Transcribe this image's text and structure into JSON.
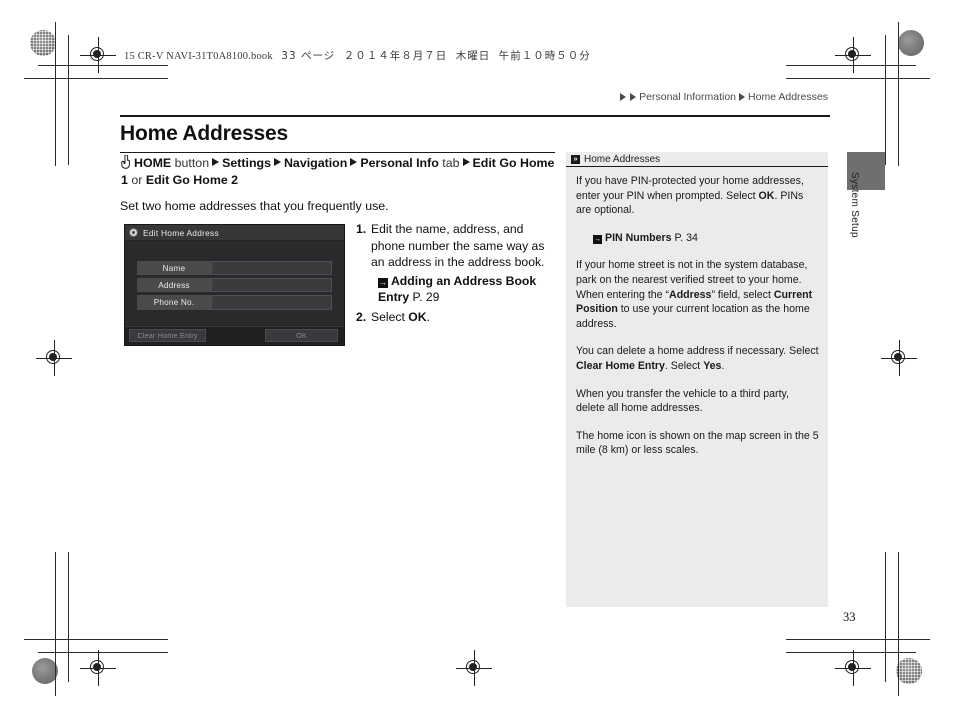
{
  "print_header": {
    "book": "15 CR-V NAVI-31T0A8100.book",
    "page_label": "33 ページ",
    "date": "２０１４年８月７日",
    "weekday": "木曜日",
    "time": "午前１０時５０分"
  },
  "breadcrumb": {
    "level1": "Personal Information",
    "level2": "Home Addresses"
  },
  "main": {
    "title": "Home Addresses",
    "nav_path": {
      "hand_icon": "hand-pointer-icon",
      "p1_bold": "HOME",
      "p1_light": " button",
      "p2": "Settings",
      "p3": "Navigation",
      "p4_bold": "Personal Info",
      "p4_light": " tab",
      "p5": "Edit Go Home 1",
      "joiner": " or ",
      "p6": "Edit Go Home 2"
    },
    "lead": "Set two home addresses that you frequently use."
  },
  "device_screenshot": {
    "title": "Edit Home Address",
    "title_icon": "gear-icon",
    "fields": [
      {
        "label": "Name",
        "value": ""
      },
      {
        "label": "Address",
        "value": ""
      },
      {
        "label": "Phone No.",
        "value": ""
      }
    ],
    "clear_button": "Clear Home Entry",
    "ok_button": "OK"
  },
  "steps": [
    {
      "num": "1.",
      "text": "Edit the name, address, and phone number the same way as an address in the address book.",
      "xref": {
        "icon": "jump-ref-icon",
        "label": "Adding an Address Book Entry",
        "page": "P. 29"
      }
    },
    {
      "num": "2.",
      "text_pre": "Select ",
      "text_bold": "OK",
      "text_post": "."
    }
  ],
  "note_panel": {
    "header_icon": "note-marker-icon",
    "header": "Home Addresses",
    "paragraphs": [
      {
        "runs": [
          {
            "t": "If you have PIN-protected your home addresses, enter your PIN when prompted. Select ",
            "b": false
          },
          {
            "t": "OK",
            "b": true
          },
          {
            "t": ". PINs are optional.",
            "b": false
          }
        ]
      },
      {
        "runs": [
          {
            "t": "If your home street is not in the system database, park on the nearest verified street to your home. When entering the “",
            "b": false
          },
          {
            "t": "Address",
            "b": true
          },
          {
            "t": "” field, select ",
            "b": false
          },
          {
            "t": "Current Position",
            "b": true
          },
          {
            "t": " to use your current location as the home address.",
            "b": false
          }
        ]
      },
      {
        "runs": [
          {
            "t": "You can delete a home address if necessary. Select ",
            "b": false
          },
          {
            "t": "Clear Home Entry",
            "b": true
          },
          {
            "t": ". Select ",
            "b": false
          },
          {
            "t": "Yes",
            "b": true
          },
          {
            "t": ".",
            "b": false
          }
        ]
      },
      {
        "runs": [
          {
            "t": "When you transfer the vehicle to a third party, delete all home addresses.",
            "b": false
          }
        ]
      },
      {
        "runs": [
          {
            "t": "The home icon is shown on the map screen in the 5 mile (8 km) or less scales.",
            "b": false
          }
        ]
      }
    ],
    "xref": {
      "icon": "jump-ref-icon",
      "label": "PIN Numbers",
      "page": "P. 34"
    }
  },
  "thumb_tab": {
    "label": "System Setup"
  },
  "page_number": "33",
  "colors": {
    "note_bg": "#ebebeb",
    "thumb_tab": "#6f6f6f",
    "device_bg": "#2a2a2c",
    "device_titlebar": "#37373a",
    "field_label": "#4a4a4d"
  }
}
